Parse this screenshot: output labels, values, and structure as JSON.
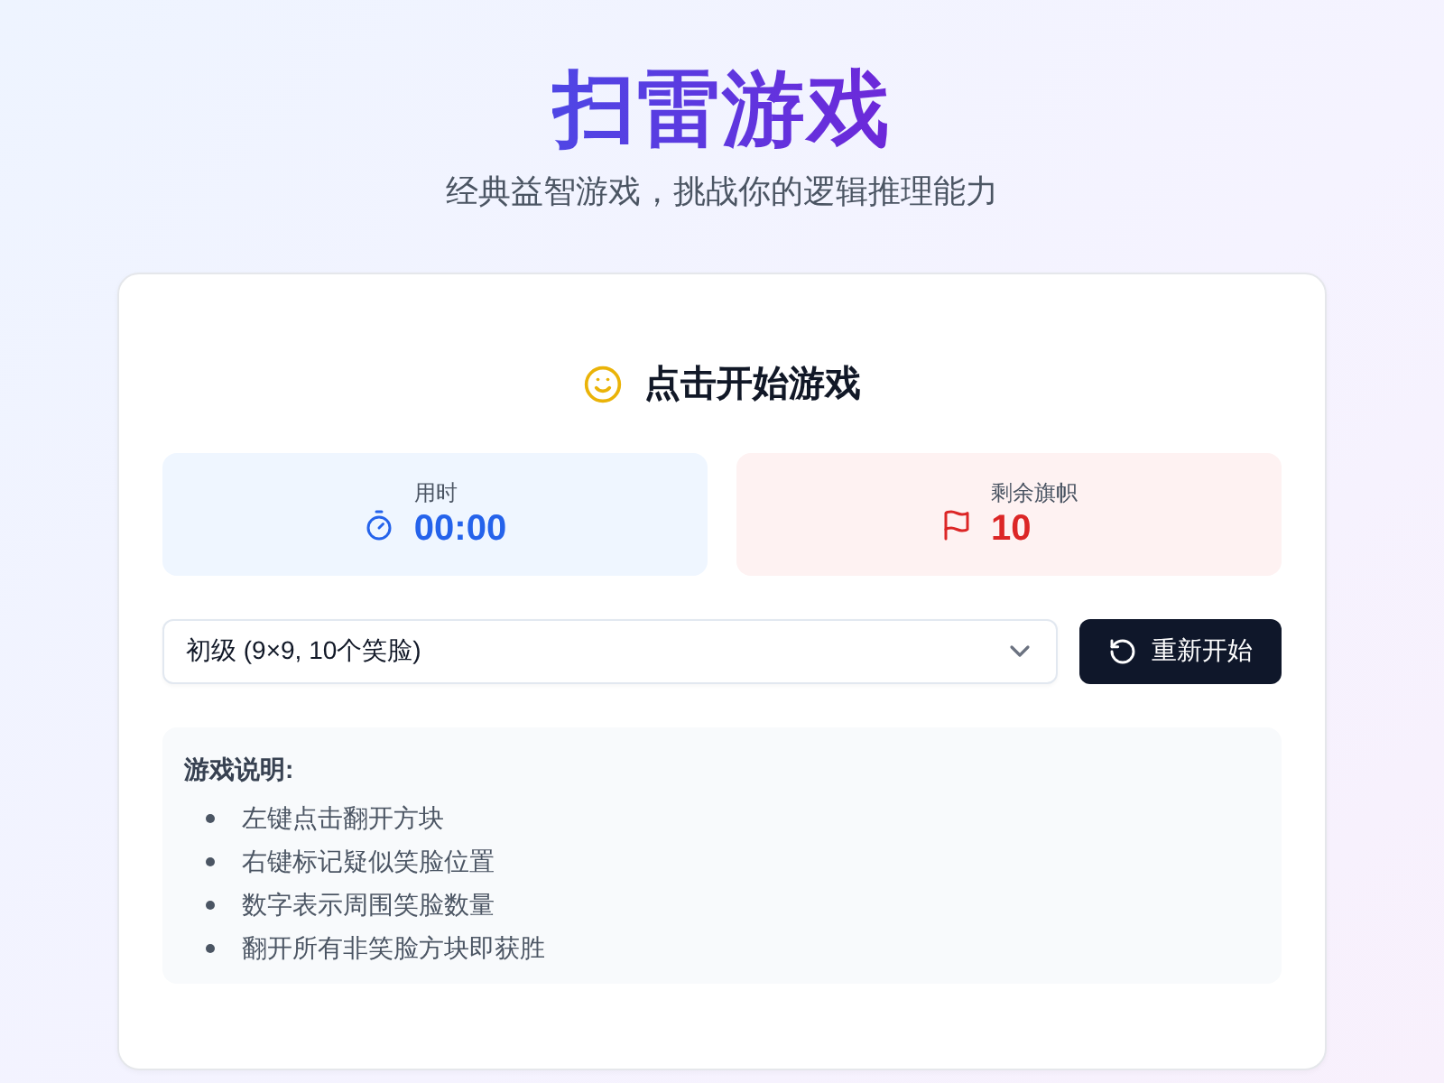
{
  "header": {
    "title": "扫雷游戏",
    "subtitle": "经典益智游戏，挑战你的逻辑推理能力"
  },
  "status": {
    "text": "点击开始游戏"
  },
  "stats": [
    {
      "kind": "timer",
      "label": "用时",
      "value": "00:00"
    },
    {
      "kind": "flags",
      "label": "剩余旗帜",
      "value": "10"
    }
  ],
  "difficulty": {
    "value": "初级 (9×9, 10个笑脸)"
  },
  "restart_button": {
    "label": "重新开始"
  },
  "rules": {
    "title": "游戏说明:",
    "items": [
      "左键点击翻开方块",
      "右键标记疑似笑脸位置",
      "数字表示周围笑脸数量",
      "翻开所有非笑脸方块即获胜"
    ]
  }
}
